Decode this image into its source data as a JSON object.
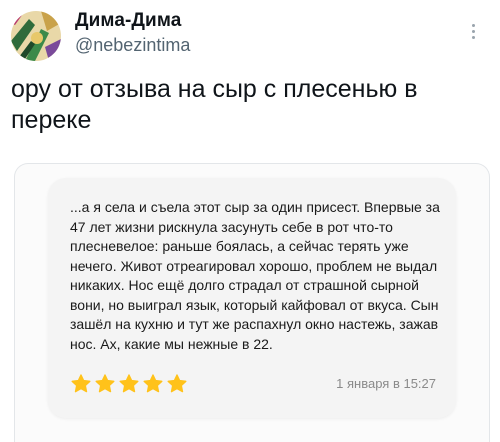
{
  "author": {
    "display_name": "Дима-Дима",
    "handle": "@nebezintima"
  },
  "tweet": {
    "text": "ору от отзыва на сыр с плесенью в переке"
  },
  "review": {
    "text": "...а я села и съела этот сыр за один присест. Впервые за 47 лет жизни рискнула засунуть себе в рот что-то плесневелое: раньше боялась, а сейчас терять уже нечего. Живот отреагировал хорошо, проблем не выдал никаких. Нос ещё долго страдал от страшной сырной вони, но выиграл язык, который кайфовал от вкуса. Сын зашёл на кухню и тут же распахнул окно настежь, зажав нос. Ах, какие мы нежные в 22.",
    "rating": 5,
    "rating_max": 5,
    "date": "1 января в 15:27"
  },
  "colors": {
    "star": "#ffc21a",
    "handle": "#536471",
    "card_bg": "#f4f4f4"
  },
  "icons": {
    "more": "more-vertical-icon",
    "star": "star-icon"
  }
}
